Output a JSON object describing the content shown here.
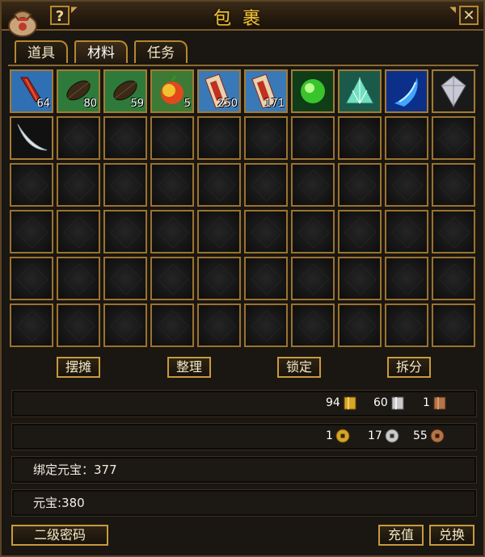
{
  "window": {
    "title": "包裹",
    "help_label": "?",
    "close_label": "✕"
  },
  "tabs": [
    {
      "label": "道具"
    },
    {
      "label": "材料"
    },
    {
      "label": "任务"
    }
  ],
  "items": [
    {
      "icon": "red-chili-icon",
      "count": "64"
    },
    {
      "icon": "beetle-leaf-icon",
      "count": "80"
    },
    {
      "icon": "beetle-leaf-icon",
      "count": "59"
    },
    {
      "icon": "rainbow-fruit-icon",
      "count": "5"
    },
    {
      "icon": "scroll-talisman-icon",
      "count": "250"
    },
    {
      "icon": "scroll-talisman-icon",
      "count": "171"
    },
    {
      "icon": "green-orb-icon",
      "count": ""
    },
    {
      "icon": "jade-fan-icon",
      "count": ""
    },
    {
      "icon": "blue-swirl-icon",
      "count": ""
    },
    {
      "icon": "crystal-gem-icon",
      "count": ""
    },
    {
      "icon": "silver-crescent-icon",
      "count": ""
    }
  ],
  "actions": {
    "stall_label": "摆摊",
    "sort_label": "整理",
    "lock_label": "锁定",
    "split_label": "拆分"
  },
  "currency": {
    "gold_bar": "94",
    "silver_bar": "60",
    "copper_bar": "1",
    "gold_coin": "1",
    "silver_coin": "17",
    "copper_coin": "55"
  },
  "info": {
    "bound_yuanbao_label": "绑定元宝：377",
    "yuanbao_label": "元宝:380"
  },
  "footer": {
    "password_label": "二级密码",
    "recharge_label": "充值",
    "exchange_label": "兑换"
  },
  "colors": {
    "frame_gold": "#b8872e",
    "title_gold": "#f0c23a",
    "background": "#1a1611"
  }
}
